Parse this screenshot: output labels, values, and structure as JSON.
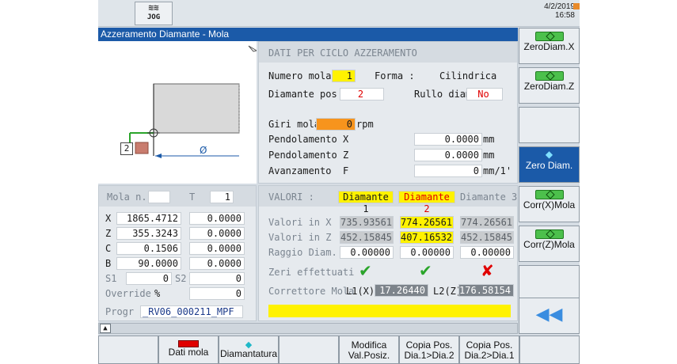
{
  "header": {
    "mode": "JOG",
    "date": "4/2/2019",
    "time": "16:58"
  },
  "title": "Azzeramento Diamante - Mola",
  "drawing": {
    "wheel_number": "2",
    "diameter_symbol": "Ø"
  },
  "cycle": {
    "heading": "DATI PER CICLO AZZERAMENTO",
    "numero_mola_label": "Numero mola",
    "numero_mola": "1",
    "forma_label": "Forma :",
    "forma": "Cilindrica",
    "diamante_pos_label": "Diamante pos :",
    "diamante_pos": "2",
    "rullo_label": "Rullo diam.:",
    "rullo": "No",
    "giri_label": "Giri mola",
    "giri_value": "0",
    "giri_unit": "rpm",
    "pend_label": "Pendolamento",
    "pend_x_axis": "X",
    "pend_x": "0.0000",
    "pend_x_unit": "mm",
    "pend_z_axis": "Z",
    "pend_z": "0.0000",
    "pend_z_unit": "mm",
    "avanz_label": "Avanzamento",
    "avanz_axis": "F",
    "avanz": "0",
    "avanz_unit": "mm/1'"
  },
  "mola_info": {
    "mola_label": "Mola n.",
    "t_label": "T",
    "t_value": "1",
    "rows": [
      {
        "axis": "X",
        "v1": "1865.4712",
        "v2": "0.0000"
      },
      {
        "axis": "Z",
        "v1": "355.3243",
        "v2": "0.0000"
      },
      {
        "axis": "C",
        "v1": "0.1506",
        "v2": "0.0000"
      },
      {
        "axis": "B",
        "v1": "90.0000",
        "v2": "0.0000"
      }
    ],
    "s1_label": "S1",
    "s1_value": "0",
    "s2_label": "S2",
    "s2_value": "0",
    "override_label": "Override",
    "override_unit": "%",
    "override_value": "0",
    "progr_label": "Progr :",
    "progr_value": "_RV06_000211_MPF"
  },
  "valori": {
    "label": "VALORI :",
    "columns": [
      "Diamante 1",
      "Diamante 2",
      "Diamante 3"
    ],
    "x_label": "Valori in X",
    "x": [
      "735.93561",
      "774.26561",
      "774.26561"
    ],
    "z_label": "Valori in Z",
    "z": [
      "452.15845",
      "407.16532",
      "452.15845"
    ],
    "r_label": "Raggio Diam.",
    "r": [
      "0.00000",
      "0.00000",
      "0.00000"
    ],
    "zeri_label": "Zeri effettuati :",
    "corr_label": "Correttore Mola",
    "l1_label": "L1(X)",
    "l1": "17.26440",
    "l2_label": "L2(Z)",
    "l2": "176.58154"
  },
  "softkeys_right": [
    "ZeroDiam.X",
    "ZeroDiam.Z",
    "",
    "Zero Diam.",
    "Corr(X)Mola",
    "Corr(Z)Mola",
    "",
    ""
  ],
  "softkeys_bottom": [
    {
      "l1": "",
      "l2": ""
    },
    {
      "l1": "",
      "l2": "Dati mola"
    },
    {
      "l1": "",
      "l2": "Diamantatura"
    },
    {
      "l1": "",
      "l2": ""
    },
    {
      "l1": "Modifica",
      "l2": "Val.Posiz."
    },
    {
      "l1": "Copia Pos.",
      "l2": "Dia.1>Dia.2"
    },
    {
      "l1": "Copia Pos.",
      "l2": "Dia.2>Dia.1"
    },
    {
      "l1": "",
      "l2": ""
    }
  ],
  "colors": {
    "title_bg": "#1b5aa8",
    "highlight": "#fff200",
    "active_diamond": "#e00000",
    "ok": "#2aa52a"
  }
}
